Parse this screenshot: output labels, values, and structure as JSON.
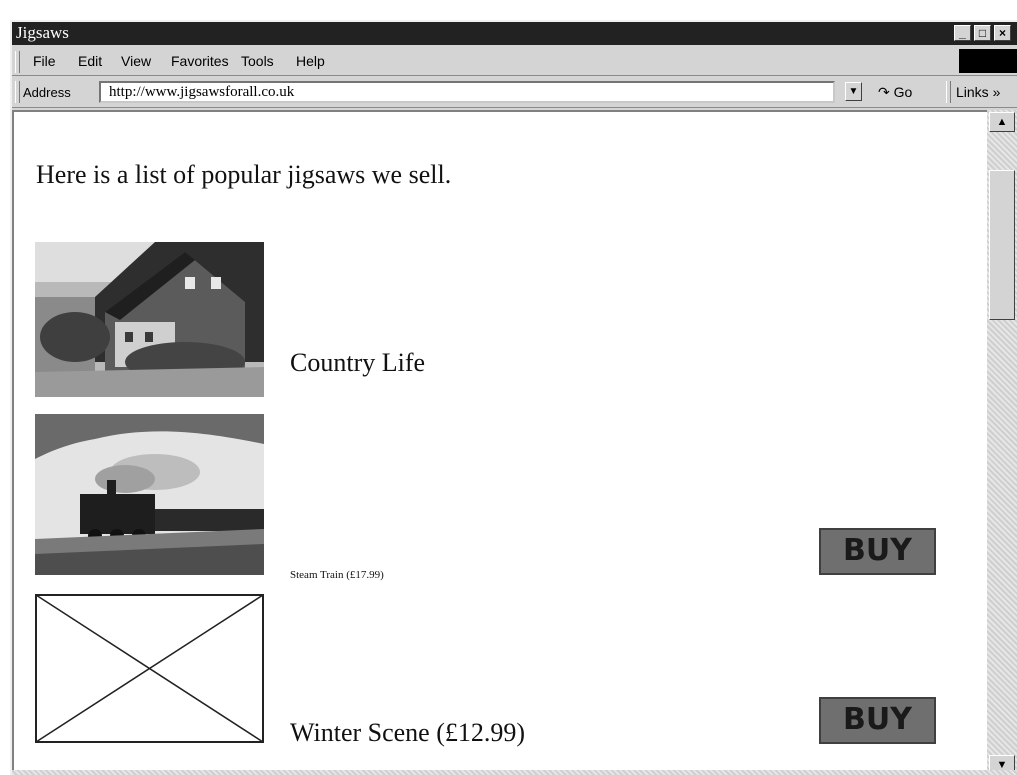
{
  "window": {
    "title": "Jigsaws"
  },
  "window_controls": {
    "minimize": "_",
    "maximize": "□",
    "close": "×"
  },
  "menu": [
    {
      "label": "File"
    },
    {
      "label": "Edit"
    },
    {
      "label": "View"
    },
    {
      "label": "Favorites"
    },
    {
      "label": "Tools"
    },
    {
      "label": "Help"
    }
  ],
  "address": {
    "label": "Address",
    "url": "http://www.jigsawsforall.co.uk",
    "go_label": "Go",
    "go_icon": "go-arrow-icon",
    "links_label": "Links »"
  },
  "page": {
    "intro": "Here is a list of popular jigsaws we sell.",
    "products": [
      {
        "caption": "Country Life",
        "image": "country-cottage-photo"
      },
      {
        "caption": "Steam Train (£17.99)",
        "image": "steam-train-photo",
        "buy_label": "BUY"
      },
      {
        "caption": "Winter Scene (£12.99)",
        "image": "broken-image-placeholder",
        "buy_label": "BUY"
      }
    ]
  },
  "colors": {
    "titlebar": "#222222",
    "chrome": "#d4d4d4",
    "buy_button": "#6f6f6f"
  }
}
